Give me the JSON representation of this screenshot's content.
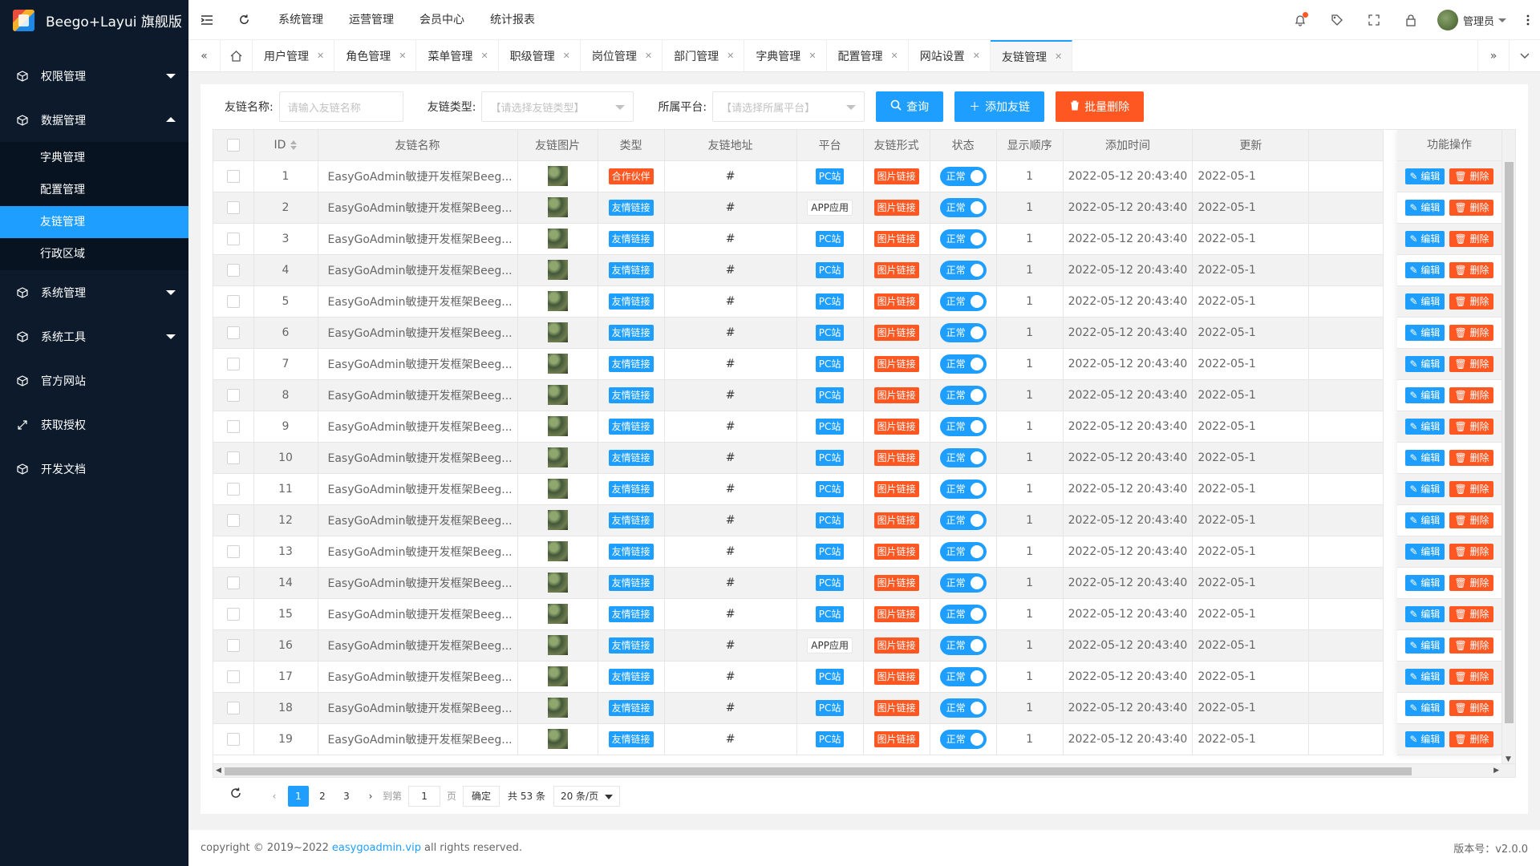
{
  "app": {
    "title": "Beego+Layui 旗舰版"
  },
  "sidebar": {
    "items": [
      {
        "label": "权限管理",
        "icon": "cube-icon"
      },
      {
        "label": "数据管理",
        "icon": "cube-icon"
      },
      {
        "label": "系统管理",
        "icon": "cube-icon"
      },
      {
        "label": "系统工具",
        "icon": "cube-icon"
      },
      {
        "label": "官方网站",
        "icon": "cube-icon"
      },
      {
        "label": "获取授权",
        "icon": "arrows-icon"
      },
      {
        "label": "开发文档",
        "icon": "cube-icon"
      }
    ],
    "submenu": [
      "字典管理",
      "配置管理",
      "友链管理",
      "行政区域"
    ]
  },
  "header": {
    "nav": [
      "系统管理",
      "运营管理",
      "会员中心",
      "统计报表"
    ],
    "user": "管理员"
  },
  "tabs": [
    "用户管理",
    "角色管理",
    "菜单管理",
    "职级管理",
    "岗位管理",
    "部门管理",
    "字典管理",
    "配置管理",
    "网站设置",
    "友链管理"
  ],
  "search": {
    "name_label": "友链名称:",
    "name_placeholder": "请输入友链名称",
    "type_label": "友链类型:",
    "type_placeholder": "【请选择友链类型】",
    "platform_label": "所属平台:",
    "platform_placeholder": "【请选择所属平台】",
    "query_btn": "查询",
    "add_btn": "添加友链",
    "batch_delete_btn": "批量删除"
  },
  "table": {
    "columns": [
      "ID",
      "友链名称",
      "友链图片",
      "类型",
      "友链地址",
      "平台",
      "友链形式",
      "状态",
      "显示顺序",
      "添加时间",
      "更新"
    ],
    "ops_header": "功能操作",
    "edit_label": "编辑",
    "delete_label": "删除",
    "rows": [
      {
        "id": "1",
        "name": "EasyGoAdmin敏捷开发框架Beeg...",
        "type": "合作伙伴",
        "url": "#",
        "platform": "PC站",
        "form": "图片链接",
        "status": "正常",
        "order": "1",
        "created": "2022-05-12 20:43:40",
        "updated": "2022-05-1"
      },
      {
        "id": "2",
        "name": "EasyGoAdmin敏捷开发框架Beeg...",
        "type": "友情链接",
        "url": "#",
        "platform": "APP应用",
        "form": "图片链接",
        "status": "正常",
        "order": "1",
        "created": "2022-05-12 20:43:40",
        "updated": "2022-05-1"
      },
      {
        "id": "3",
        "name": "EasyGoAdmin敏捷开发框架Beeg...",
        "type": "友情链接",
        "url": "#",
        "platform": "PC站",
        "form": "图片链接",
        "status": "正常",
        "order": "1",
        "created": "2022-05-12 20:43:40",
        "updated": "2022-05-1"
      },
      {
        "id": "4",
        "name": "EasyGoAdmin敏捷开发框架Beeg...",
        "type": "友情链接",
        "url": "#",
        "platform": "PC站",
        "form": "图片链接",
        "status": "正常",
        "order": "1",
        "created": "2022-05-12 20:43:40",
        "updated": "2022-05-1"
      },
      {
        "id": "5",
        "name": "EasyGoAdmin敏捷开发框架Beeg...",
        "type": "友情链接",
        "url": "#",
        "platform": "PC站",
        "form": "图片链接",
        "status": "正常",
        "order": "1",
        "created": "2022-05-12 20:43:40",
        "updated": "2022-05-1"
      },
      {
        "id": "6",
        "name": "EasyGoAdmin敏捷开发框架Beeg...",
        "type": "友情链接",
        "url": "#",
        "platform": "PC站",
        "form": "图片链接",
        "status": "正常",
        "order": "1",
        "created": "2022-05-12 20:43:40",
        "updated": "2022-05-1"
      },
      {
        "id": "7",
        "name": "EasyGoAdmin敏捷开发框架Beeg...",
        "type": "友情链接",
        "url": "#",
        "platform": "PC站",
        "form": "图片链接",
        "status": "正常",
        "order": "1",
        "created": "2022-05-12 20:43:40",
        "updated": "2022-05-1"
      },
      {
        "id": "8",
        "name": "EasyGoAdmin敏捷开发框架Beeg...",
        "type": "友情链接",
        "url": "#",
        "platform": "PC站",
        "form": "图片链接",
        "status": "正常",
        "order": "1",
        "created": "2022-05-12 20:43:40",
        "updated": "2022-05-1"
      },
      {
        "id": "9",
        "name": "EasyGoAdmin敏捷开发框架Beeg...",
        "type": "友情链接",
        "url": "#",
        "platform": "PC站",
        "form": "图片链接",
        "status": "正常",
        "order": "1",
        "created": "2022-05-12 20:43:40",
        "updated": "2022-05-1"
      },
      {
        "id": "10",
        "name": "EasyGoAdmin敏捷开发框架Beeg...",
        "type": "友情链接",
        "url": "#",
        "platform": "PC站",
        "form": "图片链接",
        "status": "正常",
        "order": "1",
        "created": "2022-05-12 20:43:40",
        "updated": "2022-05-1"
      },
      {
        "id": "11",
        "name": "EasyGoAdmin敏捷开发框架Beeg...",
        "type": "友情链接",
        "url": "#",
        "platform": "PC站",
        "form": "图片链接",
        "status": "正常",
        "order": "1",
        "created": "2022-05-12 20:43:40",
        "updated": "2022-05-1"
      },
      {
        "id": "12",
        "name": "EasyGoAdmin敏捷开发框架Beeg...",
        "type": "友情链接",
        "url": "#",
        "platform": "PC站",
        "form": "图片链接",
        "status": "正常",
        "order": "1",
        "created": "2022-05-12 20:43:40",
        "updated": "2022-05-1"
      },
      {
        "id": "13",
        "name": "EasyGoAdmin敏捷开发框架Beeg...",
        "type": "友情链接",
        "url": "#",
        "platform": "PC站",
        "form": "图片链接",
        "status": "正常",
        "order": "1",
        "created": "2022-05-12 20:43:40",
        "updated": "2022-05-1"
      },
      {
        "id": "14",
        "name": "EasyGoAdmin敏捷开发框架Beeg...",
        "type": "友情链接",
        "url": "#",
        "platform": "PC站",
        "form": "图片链接",
        "status": "正常",
        "order": "1",
        "created": "2022-05-12 20:43:40",
        "updated": "2022-05-1"
      },
      {
        "id": "15",
        "name": "EasyGoAdmin敏捷开发框架Beeg...",
        "type": "友情链接",
        "url": "#",
        "platform": "PC站",
        "form": "图片链接",
        "status": "正常",
        "order": "1",
        "created": "2022-05-12 20:43:40",
        "updated": "2022-05-1"
      },
      {
        "id": "16",
        "name": "EasyGoAdmin敏捷开发框架Beeg...",
        "type": "友情链接",
        "url": "#",
        "platform": "APP应用",
        "form": "图片链接",
        "status": "正常",
        "order": "1",
        "created": "2022-05-12 20:43:40",
        "updated": "2022-05-1"
      },
      {
        "id": "17",
        "name": "EasyGoAdmin敏捷开发框架Beeg...",
        "type": "友情链接",
        "url": "#",
        "platform": "PC站",
        "form": "图片链接",
        "status": "正常",
        "order": "1",
        "created": "2022-05-12 20:43:40",
        "updated": "2022-05-1"
      },
      {
        "id": "18",
        "name": "EasyGoAdmin敏捷开发框架Beeg...",
        "type": "友情链接",
        "url": "#",
        "platform": "PC站",
        "form": "图片链接",
        "status": "正常",
        "order": "1",
        "created": "2022-05-12 20:43:40",
        "updated": "2022-05-1"
      },
      {
        "id": "19",
        "name": "EasyGoAdmin敏捷开发框架Beeg...",
        "type": "友情链接",
        "url": "#",
        "platform": "PC站",
        "form": "图片链接",
        "status": "正常",
        "order": "1",
        "created": "2022-05-12 20:43:40",
        "updated": "2022-05-1"
      }
    ]
  },
  "pager": {
    "pages": [
      "1",
      "2",
      "3"
    ],
    "goto_label": "到第",
    "goto_value": "1",
    "page_unit": "页",
    "confirm": "确定",
    "total": "共 53 条",
    "page_size": "20 条/页"
  },
  "footer": {
    "copyright": "copyright © 2019~2022",
    "link": "easygoadmin.vip",
    "rights": "all rights reserved.",
    "version": "版本号：v2.0.0"
  },
  "colors": {
    "sidebar_bg": "#0c1a2c",
    "accent": "#1e9fff",
    "danger": "#ff5722"
  }
}
